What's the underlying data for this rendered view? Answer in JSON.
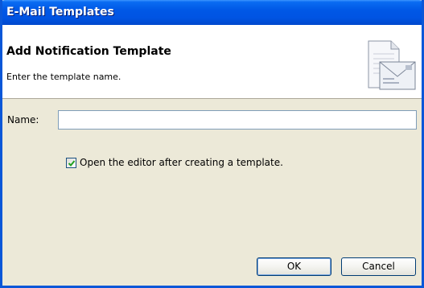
{
  "window": {
    "title": "E-Mail Templates"
  },
  "header": {
    "title": "Add Notification Template",
    "subtitle": "Enter the template name.",
    "icon": "email-template-icon"
  },
  "form": {
    "name_label": "Name:",
    "name_value": "",
    "open_editor_label": "Open the editor after creating a template.",
    "open_editor_checked": true
  },
  "buttons": {
    "ok": "OK",
    "cancel": "Cancel"
  },
  "colors": {
    "titlebar": "#0054e3",
    "frame": "#0a57d8",
    "dialog_bg": "#ece9d8"
  }
}
